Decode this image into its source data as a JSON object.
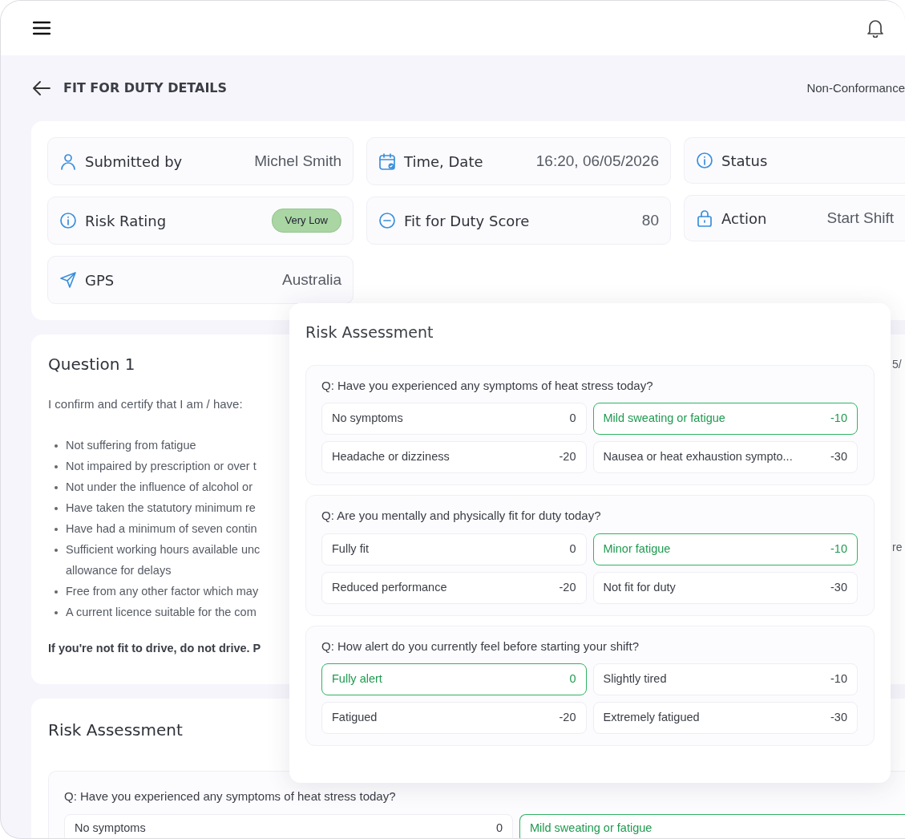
{
  "page": {
    "title": "FIT FOR DUTY DETAILS",
    "header_link": "Non-Conformance"
  },
  "details": [
    {
      "label": "Submitted by",
      "value": "Michel Smith",
      "kind": "text"
    },
    {
      "label": "Time, Date",
      "value": "16:20, 06/05/2026",
      "kind": "text"
    },
    {
      "label": "Status",
      "kind": "empty"
    },
    {
      "label": "Risk Rating",
      "value": "Very Low",
      "kind": "badge",
      "color": "#a9d6a3"
    },
    {
      "label": "Fit for Duty Score",
      "value": "80",
      "kind": "text"
    },
    {
      "label": "Action",
      "value": "Start Shift",
      "kind": "text"
    },
    {
      "label": "GPS",
      "value": "Australia",
      "kind": "text"
    }
  ],
  "question1": {
    "title": "Question 1",
    "date_fragment": "5/",
    "intro": "I confirm and certify that I am / have:",
    "items": [
      {
        "lines": [
          "Not suffering from fatigue"
        ]
      },
      {
        "lines": [
          "Not impaired by prescription or over t"
        ]
      },
      {
        "lines": [
          "Not under the influence of alcohol or"
        ]
      },
      {
        "lines": [
          "Have taken the statutory minimum re"
        ]
      },
      {
        "lines": [
          "Have had a minimum of seven contin"
        ]
      },
      {
        "lines": [
          "Sufficient working hours available unc",
          "allowance for delays"
        ],
        "tail_fragment": "re"
      },
      {
        "lines": [
          "Free from any other factor which may"
        ]
      },
      {
        "lines": [
          "A current licence suitable for the com"
        ]
      }
    ],
    "warning": "If you're not fit to drive, do not drive. P"
  },
  "risk_section": {
    "title": "Risk Assessment",
    "question": "Q: Have you experienced any symptoms of heat stress today?",
    "options": [
      {
        "label": "No symptoms",
        "score": "0",
        "selected": false
      },
      {
        "label": "Mild sweating or fatigue",
        "selected": true
      }
    ]
  },
  "popup": {
    "title": "Risk Assessment",
    "questions": [
      {
        "text": "Q: Have you experienced any symptoms of heat stress today?",
        "options": [
          {
            "label": "No symptoms",
            "score": "0",
            "selected": false
          },
          {
            "label": "Mild sweating or fatigue",
            "score": "-10",
            "selected": true
          },
          {
            "label": "Headache or dizziness",
            "score": "-20",
            "selected": false
          },
          {
            "label": "Nausea or heat exhaustion sympto...",
            "score": "-30",
            "selected": false
          }
        ]
      },
      {
        "text": "Q: Are you mentally and physically fit for duty today?",
        "options": [
          {
            "label": "Fully fit",
            "score": "0",
            "selected": false
          },
          {
            "label": "Minor fatigue",
            "score": "-10",
            "selected": true
          },
          {
            "label": "Reduced performance",
            "score": "-20",
            "selected": false
          },
          {
            "label": "Not fit for duty",
            "score": "-30",
            "selected": false
          }
        ]
      },
      {
        "text": "Q: How alert do you currently feel before starting your shift?",
        "options": [
          {
            "label": "Fully alert",
            "score": "0",
            "selected": true
          },
          {
            "label": "Slightly tired",
            "score": "-10",
            "selected": false
          },
          {
            "label": "Fatigued",
            "score": "-20",
            "selected": false
          },
          {
            "label": "Extremely fatigued",
            "score": "-30",
            "selected": false
          }
        ]
      }
    ]
  }
}
